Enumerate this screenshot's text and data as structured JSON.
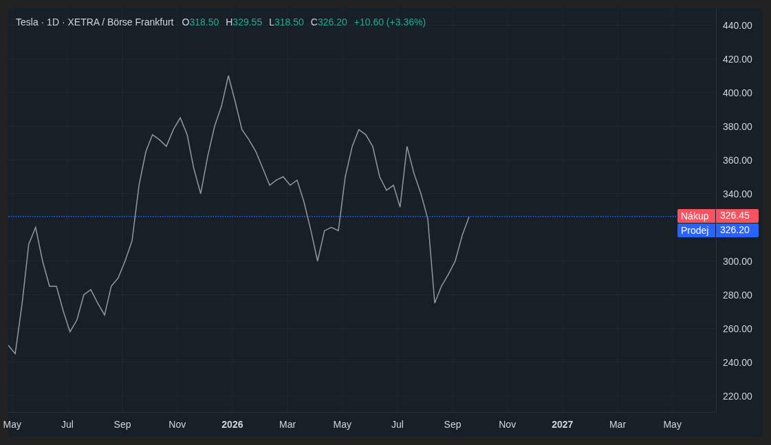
{
  "legend": {
    "title": "Tesla · 1D · XETRA / Börse Frankfurt",
    "fields": [
      {
        "label": "O",
        "value": "318.50"
      },
      {
        "label": "H",
        "value": "329.55"
      },
      {
        "label": "L",
        "value": "318.50"
      },
      {
        "label": "C",
        "value": "326.20"
      }
    ],
    "change": "+10.60 (+3.36%)"
  },
  "quotes": [
    {
      "kind": "buy",
      "label": "Nákup",
      "value": "326.45"
    },
    {
      "kind": "sell",
      "label": "Prodej",
      "value": "326.20"
    }
  ],
  "chart_data": {
    "type": "line",
    "x": [
      2025.321,
      2025.342,
      2025.363,
      2025.383,
      2025.404,
      2025.425,
      2025.446,
      2025.467,
      2025.488,
      2025.508,
      2025.529,
      2025.55,
      2025.571,
      2025.592,
      2025.613,
      2025.633,
      2025.654,
      2025.675,
      2025.696,
      2025.717,
      2025.738,
      2025.758,
      2025.779,
      2025.8,
      2025.821,
      2025.842,
      2025.863,
      2025.883,
      2025.904,
      2025.925,
      2025.946,
      2025.967,
      2025.988,
      2026.008,
      2026.029,
      2026.05,
      2026.071,
      2026.092,
      2026.113,
      2026.133,
      2026.154,
      2026.175,
      2026.196,
      2026.217,
      2026.238,
      2026.258,
      2026.279,
      2026.3,
      2026.321,
      2026.342,
      2026.363,
      2026.383,
      2026.404,
      2026.425,
      2026.446,
      2026.467,
      2026.488,
      2026.508,
      2026.529,
      2026.55,
      2026.571,
      2026.592,
      2026.613,
      2026.633,
      2026.654,
      2026.675,
      2026.696,
      2026.717
    ],
    "series": [
      {
        "color": "#9598a1",
        "values": [
          250,
          245,
          275,
          310,
          320,
          300,
          285,
          285,
          270,
          258,
          265,
          280,
          283,
          275,
          268,
          285,
          290,
          300,
          312,
          345,
          365,
          375,
          372,
          368,
          378,
          385,
          375,
          355,
          340,
          362,
          380,
          392,
          410,
          395,
          378,
          372,
          365,
          355,
          345,
          348,
          350,
          345,
          348,
          335,
          318,
          300,
          318,
          320,
          318,
          350,
          368,
          378,
          375,
          368,
          350,
          342,
          345,
          332,
          368,
          352,
          340,
          325,
          275,
          285,
          292,
          300,
          315,
          326.2
        ]
      }
    ],
    "grid": true,
    "ref_lines": [
      {
        "axis": "y",
        "value": 326.45,
        "color": "#2962ff"
      }
    ],
    "xlim": [
      2025.321,
      2027.467
    ],
    "ylim": [
      210,
      450
    ],
    "yticks": [
      {
        "value": 220,
        "label": "220.00"
      },
      {
        "value": 240,
        "label": "240.00"
      },
      {
        "value": 260,
        "label": "260.00"
      },
      {
        "value": 280,
        "label": "280.00"
      },
      {
        "value": 300,
        "label": "300.00"
      },
      {
        "value": 340,
        "label": "340.00"
      },
      {
        "value": 360,
        "label": "360.00"
      },
      {
        "value": 380,
        "label": "380.00"
      },
      {
        "value": 400,
        "label": "400.00"
      },
      {
        "value": 420,
        "label": "420.00"
      },
      {
        "value": 440,
        "label": "440.00"
      }
    ],
    "xticks": [
      {
        "value": 2025.333,
        "label": "May"
      },
      {
        "value": 2025.5,
        "label": "Jul"
      },
      {
        "value": 2025.667,
        "label": "Sep"
      },
      {
        "value": 2025.833,
        "label": "Nov"
      },
      {
        "value": 2026,
        "label": "2026"
      },
      {
        "value": 2026.167,
        "label": "Mar"
      },
      {
        "value": 2026.333,
        "label": "May"
      },
      {
        "value": 2026.5,
        "label": "Jul"
      },
      {
        "value": 2026.667,
        "label": "Sep"
      },
      {
        "value": 2026.833,
        "label": "Nov"
      },
      {
        "value": 2027,
        "label": "2027"
      },
      {
        "value": 2027.167,
        "label": "Mar"
      },
      {
        "value": 2027.333,
        "label": "May"
      }
    ]
  }
}
